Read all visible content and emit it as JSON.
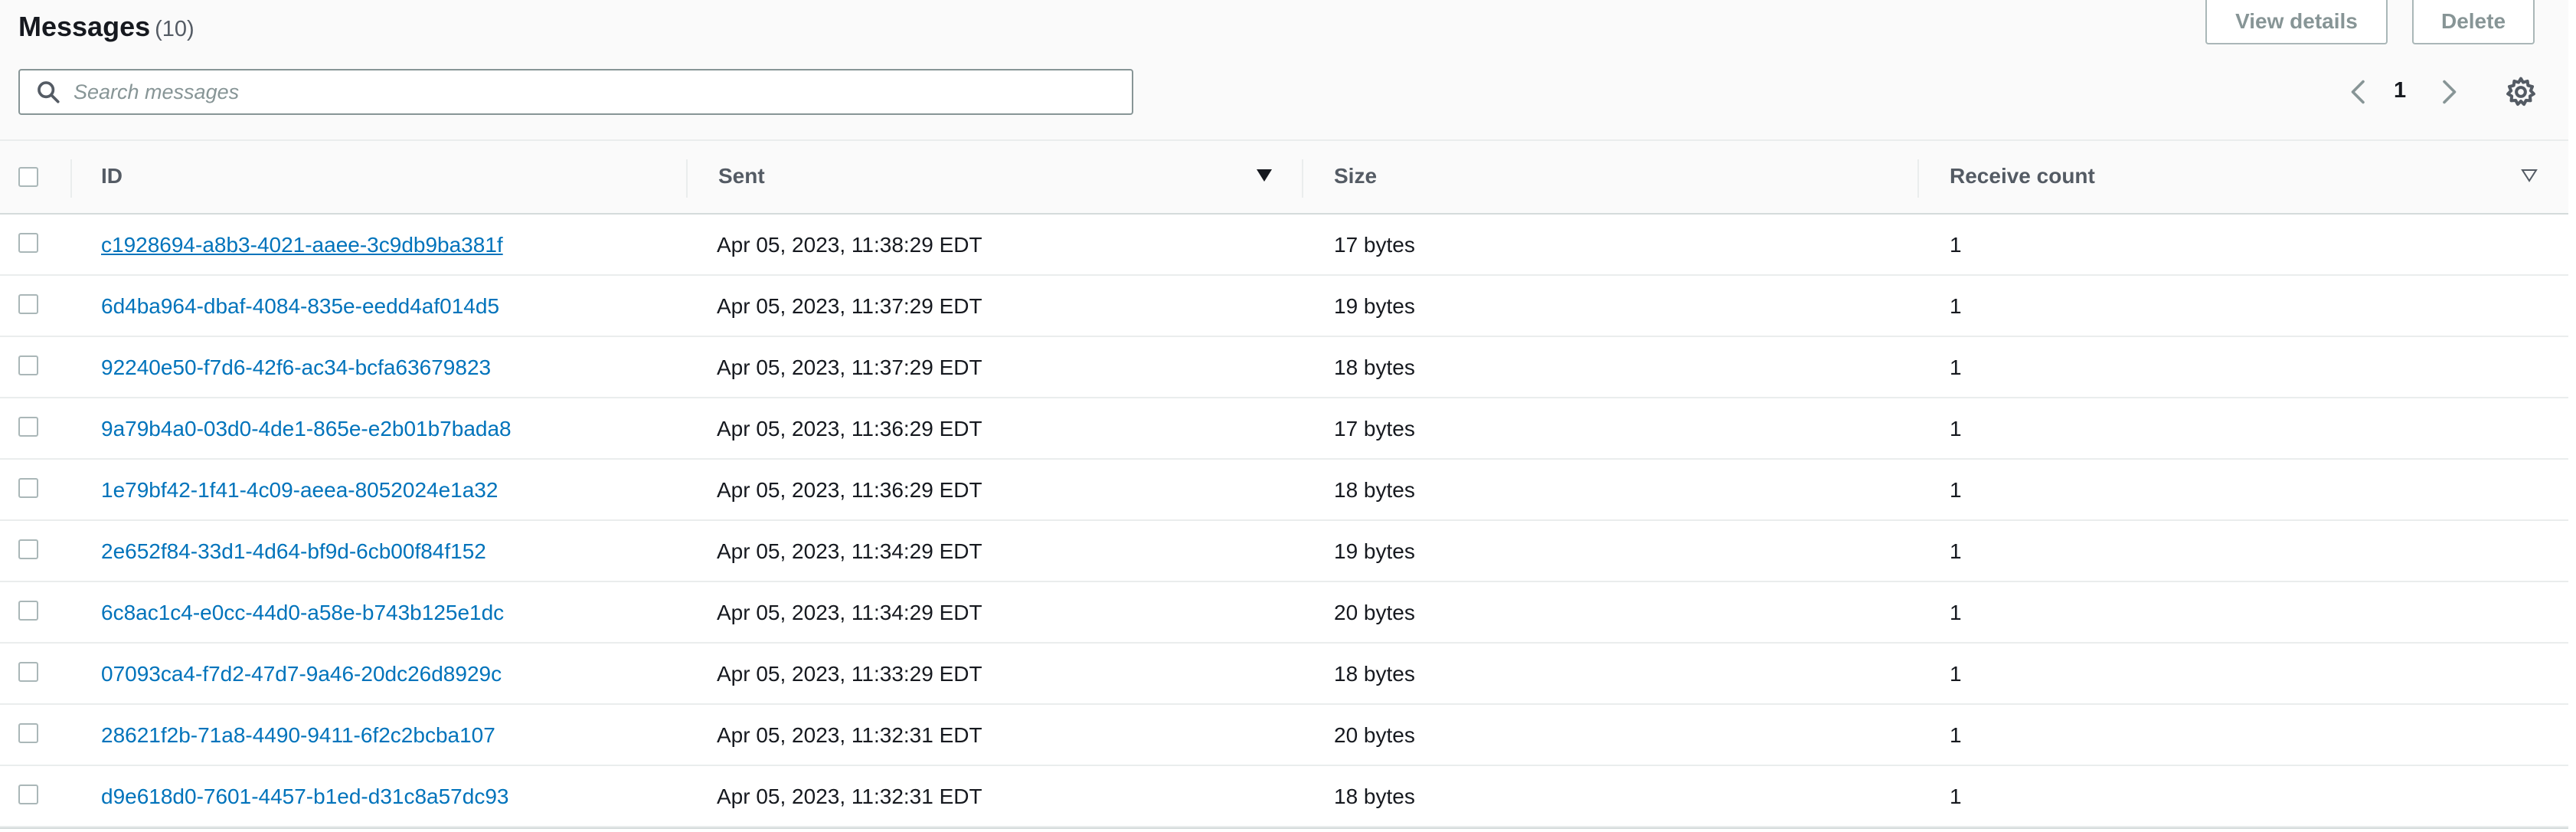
{
  "header": {
    "title": "Messages",
    "count": "(10)",
    "view_details_label": "View details",
    "delete_label": "Delete"
  },
  "search": {
    "placeholder": "Search messages",
    "value": ""
  },
  "pagination": {
    "current_page": "1"
  },
  "table": {
    "columns": [
      "ID",
      "Sent",
      "Size",
      "Receive count"
    ],
    "sorted_column": "Sent",
    "sort_direction": "descending",
    "rows": [
      {
        "id": "c1928694-a8b3-4021-aaee-3c9db9ba381f",
        "sent": "Apr 05, 2023, 11:38:29 EDT",
        "size": "17 bytes",
        "receive_count": "1"
      },
      {
        "id": "6d4ba964-dbaf-4084-835e-eedd4af014d5",
        "sent": "Apr 05, 2023, 11:37:29 EDT",
        "size": "19 bytes",
        "receive_count": "1"
      },
      {
        "id": "92240e50-f7d6-42f6-ac34-bcfa63679823",
        "sent": "Apr 05, 2023, 11:37:29 EDT",
        "size": "18 bytes",
        "receive_count": "1"
      },
      {
        "id": "9a79b4a0-03d0-4de1-865e-e2b01b7bada8",
        "sent": "Apr 05, 2023, 11:36:29 EDT",
        "size": "17 bytes",
        "receive_count": "1"
      },
      {
        "id": "1e79bf42-1f41-4c09-aeea-8052024e1a32",
        "sent": "Apr 05, 2023, 11:36:29 EDT",
        "size": "18 bytes",
        "receive_count": "1"
      },
      {
        "id": "2e652f84-33d1-4d64-bf9d-6cb00f84f152",
        "sent": "Apr 05, 2023, 11:34:29 EDT",
        "size": "19 bytes",
        "receive_count": "1"
      },
      {
        "id": "6c8ac1c4-e0cc-44d0-a58e-b743b125e1dc",
        "sent": "Apr 05, 2023, 11:34:29 EDT",
        "size": "20 bytes",
        "receive_count": "1"
      },
      {
        "id": "07093ca4-f7d2-47d7-9a46-20dc26d8929c",
        "sent": "Apr 05, 2023, 11:33:29 EDT",
        "size": "18 bytes",
        "receive_count": "1"
      },
      {
        "id": "28621f2b-71a8-4490-9411-6f2c2bcba107",
        "sent": "Apr 05, 2023, 11:32:31 EDT",
        "size": "20 bytes",
        "receive_count": "1"
      },
      {
        "id": "d9e618d0-7601-4457-b1ed-d31c8a57dc93",
        "sent": "Apr 05, 2023, 11:32:31 EDT",
        "size": "18 bytes",
        "receive_count": "1"
      }
    ]
  },
  "icons": {
    "search": "search-icon",
    "prev": "chevron-left-icon",
    "next": "chevron-right-icon",
    "settings": "gear-icon",
    "sort_desc": "caret-down-icon",
    "sortable": "caret-down-outline-icon"
  },
  "colors": {
    "link": "#0073bb",
    "header_bg": "#fafafa",
    "border": "#d5dbdb"
  }
}
